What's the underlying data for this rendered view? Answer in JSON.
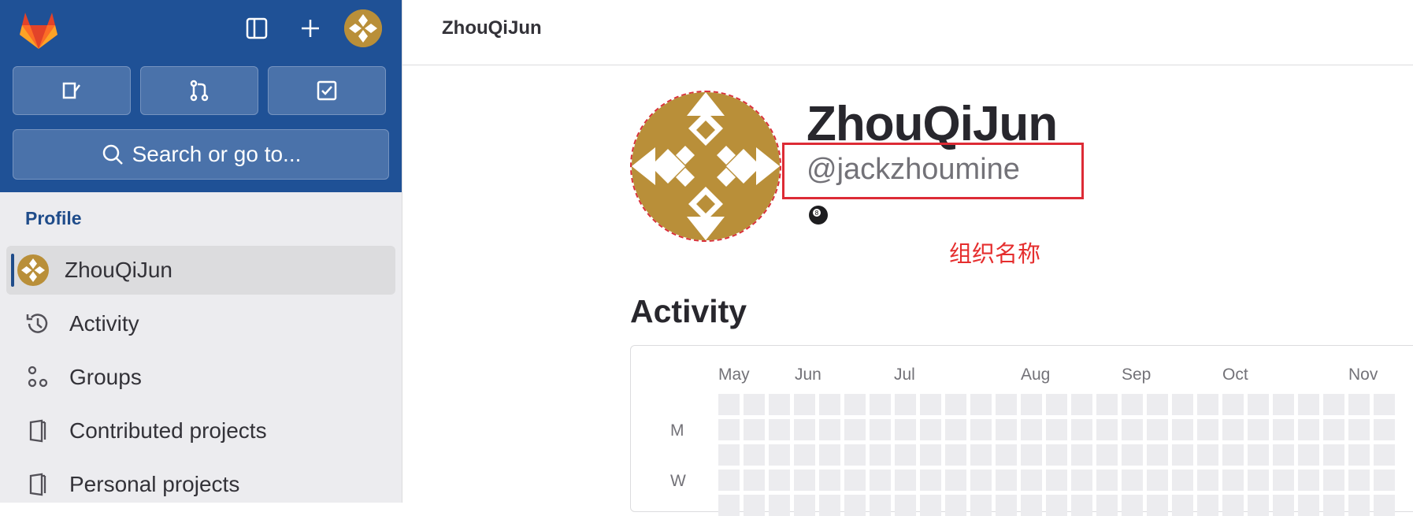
{
  "sidebar": {
    "search_label": "Search or go to...",
    "section_title": "Profile",
    "items": [
      {
        "label": "ZhouQiJun",
        "icon": "avatar",
        "active": true
      },
      {
        "label": "Activity",
        "icon": "history-icon",
        "active": false
      },
      {
        "label": "Groups",
        "icon": "groups-icon",
        "active": false
      },
      {
        "label": "Contributed projects",
        "icon": "project-icon",
        "active": false
      },
      {
        "label": "Personal projects",
        "icon": "project-icon",
        "active": false
      }
    ]
  },
  "header": {
    "breadcrumb": "ZhouQiJun"
  },
  "profile": {
    "name": "ZhouQiJun",
    "handle": "@jackzhoumine",
    "status_emoji": "🎱"
  },
  "annotation": "组织名称",
  "activity": {
    "title": "Activity",
    "months": [
      "May",
      "Jun",
      "Jul",
      "Aug",
      "Sep",
      "Oct",
      "Nov"
    ],
    "days": [
      "M",
      "W"
    ]
  },
  "colors": {
    "sidebar_top": "#1f5196",
    "brand_orange": "#fc6d26",
    "annotation_red": "#e52e2e"
  }
}
